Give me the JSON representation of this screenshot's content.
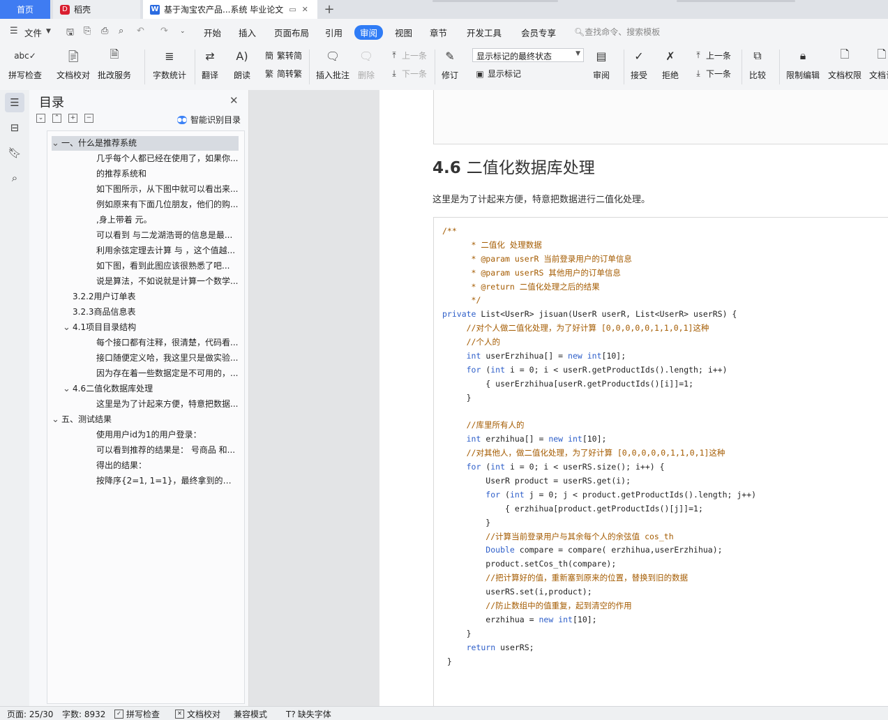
{
  "tabs": [
    {
      "label": "首页"
    },
    {
      "label": "稻壳"
    },
    {
      "label": "基于淘宝农产品...系统 毕业论文"
    }
  ],
  "new_tab_symbol": "+",
  "menu": {
    "file": "文件",
    "items": [
      "开始",
      "插入",
      "页面布局",
      "引用",
      "审阅",
      "视图",
      "章节",
      "开发工具",
      "会员专享"
    ],
    "active": "审阅",
    "search_placeholder": "查找命令、搜索模板"
  },
  "ribbon": {
    "spell_check": "拼写检查",
    "doc_proof": "文档校对",
    "revise_service": "批改服务",
    "word_count": "字数统计",
    "translate": "翻译",
    "read_aloud": "朗读",
    "to_traditional": "繁转简",
    "to_simplified": "简转繁",
    "insert_comment": "插入批注",
    "delete": "删除",
    "prev": "上一条",
    "next": "下一条",
    "revise": "修订",
    "markup_select": "显示标记的最终状态",
    "show_markup": "显示标记",
    "review": "审阅",
    "accept": "接受",
    "reject": "拒绝",
    "prev_change": "上一条",
    "next_change": "下一条",
    "compare": "比较",
    "restrict_edit": "限制编辑",
    "doc_rights": "文档权限",
    "doc_cert": "文档认"
  },
  "toc": {
    "title": "目录",
    "smart_label": "智能识别目录",
    "items": [
      {
        "text": "一、什么是推荐系统",
        "level": 1,
        "toggle": "v",
        "selected": true
      },
      {
        "text": "几乎每个人都已经在使用了，如果你...",
        "level": 3
      },
      {
        "text": "的推荐系统和",
        "level": 3
      },
      {
        "text": "如下图所示，从下图中就可以看出来...",
        "level": 3
      },
      {
        "text": "例如原来有下面几位朋友，他们的购...",
        "level": 3
      },
      {
        "text": ",身上带着 元。",
        "level": 3
      },
      {
        "text": "可以看到 与二龙湖浩哥的信息是最...",
        "level": 3
      },
      {
        "text": "利用余弦定理去计算 与 ，这个值越...",
        "level": 3
      },
      {
        "text": "如下图，看到此图应该很熟悉了吧...",
        "level": 3
      },
      {
        "text": "说是算法，不如说就是计算一个数学...",
        "level": 3
      },
      {
        "text": "3.2.2用户订单表",
        "level": 2
      },
      {
        "text": "3.2.3商品信息表",
        "level": 2
      },
      {
        "text": "4.1项目目录结构",
        "level": 2,
        "toggle": "v"
      },
      {
        "text": "每个接口都有注释，很清楚，代码看...",
        "level": 3
      },
      {
        "text": "接口随便定义哈，我这里只是做实验...",
        "level": 3
      },
      {
        "text": "因为存在着一些数据定是不可用的，...",
        "level": 3
      },
      {
        "text": "4.6二值化数据库处理",
        "level": 2,
        "toggle": "v"
      },
      {
        "text": "这里是为了计起来方便，特意把数据...",
        "level": 3
      },
      {
        "text": "五、测试结果",
        "level": 1,
        "toggle": "v"
      },
      {
        "text": "使用用户id为1的用户登录：",
        "level": 3
      },
      {
        "text": "可以看到推荐的结果是： 号商品 和...",
        "level": 3
      },
      {
        "text": "得出的结果：",
        "level": 3
      },
      {
        "text": "按降序{2=1, 1=1}，最终拿到的被推...",
        "level": 3
      }
    ]
  },
  "document": {
    "heading_number": "4.6",
    "heading_text": "二值化数据库处理",
    "paragraph": "这里是为了计起来方便，特意把数据进行二值化处理。",
    "code_lines": [
      [
        [
          "cm",
          "/**"
        ]
      ],
      [
        [
          "cm",
          "      * 二值化 处理数据"
        ]
      ],
      [
        [
          "cm",
          "      * @param userR 当前登录用户的订单信息"
        ]
      ],
      [
        [
          "cm",
          "      * @param userRS 其他用户的订单信息"
        ]
      ],
      [
        [
          "cm",
          "      * @return 二值化处理之后的结果"
        ]
      ],
      [
        [
          "cm",
          "      */"
        ]
      ],
      [
        [
          "kw",
          "private"
        ],
        [
          "",
          " List<UserR> jisuan(UserR userR, List<UserR> userRS) {"
        ]
      ],
      [
        [
          "cm",
          "     //对个人做二值化处理，为了好计算 [0,0,0,0,0,1,1,0,1]这种"
        ]
      ],
      [
        [
          "cm",
          "     //个人的"
        ]
      ],
      [
        [
          "kw",
          "     int"
        ],
        [
          "",
          " userErzhihua[] = "
        ],
        [
          "kw",
          "new"
        ],
        [
          "",
          " "
        ],
        [
          "kw",
          "int"
        ],
        [
          "",
          "[10];"
        ]
      ],
      [
        [
          "kw",
          "     for"
        ],
        [
          "",
          " ("
        ],
        [
          "kw",
          "int"
        ],
        [
          "",
          " i = 0; i < userR.getProductIds().length; i++)"
        ]
      ],
      [
        [
          "",
          "         { userErzhihua[userR.getProductIds()[i]]=1;"
        ]
      ],
      [
        [
          "",
          "     }"
        ]
      ],
      [
        [
          "",
          ""
        ]
      ],
      [
        [
          "cm",
          "     //库里所有人的"
        ]
      ],
      [
        [
          "kw",
          "     int"
        ],
        [
          "",
          " erzhihua[] = "
        ],
        [
          "kw",
          "new"
        ],
        [
          "",
          " "
        ],
        [
          "kw",
          "int"
        ],
        [
          "",
          "[10];"
        ]
      ],
      [
        [
          "cm",
          "     //对其他人，做二值化处理，为了好计算 [0,0,0,0,0,1,1,0,1]这种"
        ]
      ],
      [
        [
          "kw",
          "     for"
        ],
        [
          "",
          " ("
        ],
        [
          "kw",
          "int"
        ],
        [
          "",
          " i = 0; i < userRS.size(); i++) {"
        ]
      ],
      [
        [
          "",
          "         UserR product = userRS.get(i);"
        ]
      ],
      [
        [
          "kw",
          "         for"
        ],
        [
          "",
          " ("
        ],
        [
          "kw",
          "int"
        ],
        [
          "",
          " j = 0; j < product.getProductIds().length; j++)"
        ]
      ],
      [
        [
          "",
          "             { erzhihua[product.getProductIds()[j]]=1;"
        ]
      ],
      [
        [
          "",
          "         }"
        ]
      ],
      [
        [
          "cm",
          "         //计算当前登录用户与其余每个人的余弦值 cos_th"
        ]
      ],
      [
        [
          "kw",
          "         Double"
        ],
        [
          "",
          " compare = compare( erzhihua,userErzhihua);"
        ]
      ],
      [
        [
          "",
          "         product.setCos_th(compare);"
        ]
      ],
      [
        [
          "cm",
          "         //把计算好的值，重新塞到原来的位置，替换到旧的数据"
        ]
      ],
      [
        [
          "",
          "         userRS.set(i,product);"
        ]
      ],
      [
        [
          "cm",
          "         //防止数组中的值重复，起到清空的作用"
        ]
      ],
      [
        [
          "",
          "         erzhihua = "
        ],
        [
          "kw",
          "new"
        ],
        [
          "",
          " "
        ],
        [
          "kw",
          "int"
        ],
        [
          "",
          "[10];"
        ]
      ],
      [
        [
          "",
          "     }"
        ]
      ],
      [
        [
          "kw",
          "     return"
        ],
        [
          "",
          " userRS;"
        ]
      ],
      [
        [
          "",
          " }"
        ]
      ]
    ]
  },
  "status": {
    "page": "页面: 25/30",
    "word_count": "字数: 8932",
    "spell_check": "拼写检查",
    "doc_proof": "文档校对",
    "compat_mode": "兼容模式",
    "missing_font": "缺失字体"
  },
  "colors": {
    "accent": "#2f7cf6",
    "code_comment": "#a45b00",
    "code_keyword": "#2d5ec9"
  }
}
